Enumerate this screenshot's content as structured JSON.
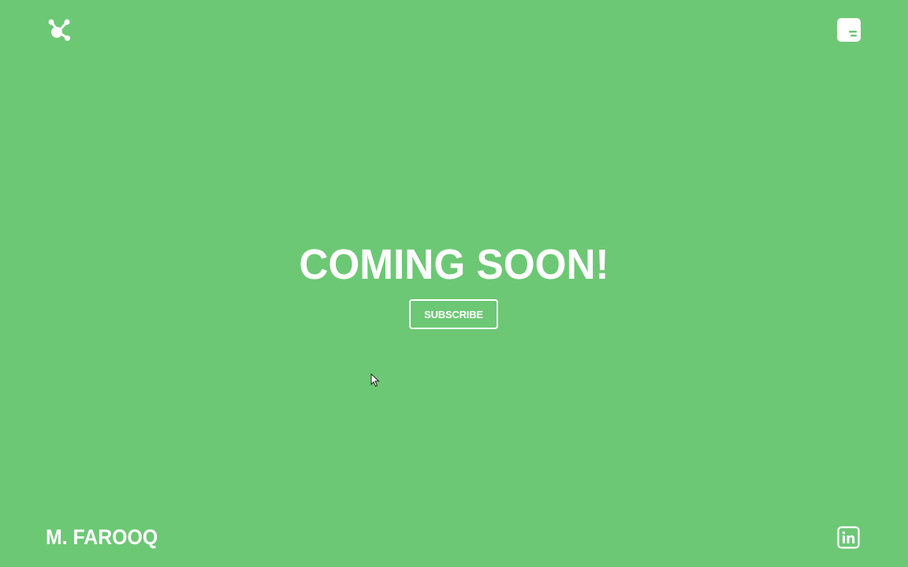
{
  "header": {
    "logo_icon": "molecule-logo-icon",
    "menu_icon": "menu-panel-icon"
  },
  "hero": {
    "headline": "COMING SOON!",
    "subscribe_label": "SUBSCRIBE"
  },
  "footer": {
    "brand_name": "M. FAROOQ",
    "social_icon": "linkedin-icon"
  },
  "colors": {
    "background": "#6cc874",
    "foreground": "#ffffff"
  }
}
